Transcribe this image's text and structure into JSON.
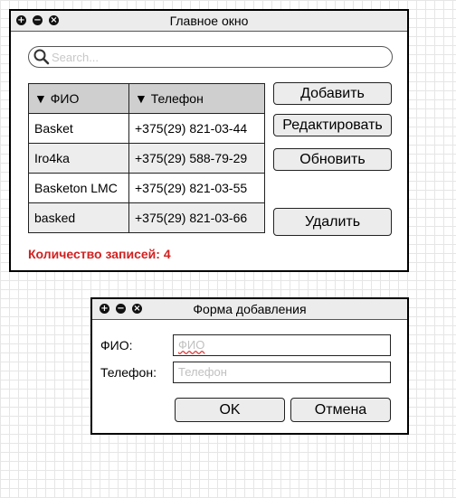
{
  "main_window": {
    "title": "Главное окно",
    "search_placeholder": "Search...",
    "table": {
      "columns": [
        "▼ ФИО",
        "▼ Телефон"
      ],
      "rows": [
        {
          "name": "Basket",
          "phone": "+375(29) 821-03-44"
        },
        {
          "name": "Iro4ka",
          "phone": "+375(29) 588-79-29"
        },
        {
          "name": "Basketon LMC",
          "phone": "+375(29) 821-03-55"
        },
        {
          "name": "basked",
          "phone": "+375(29) 821-03-66"
        }
      ]
    },
    "buttons": {
      "add": "Добавить",
      "edit": "Редактировать",
      "refresh": "Обновить",
      "delete": "Удалить"
    },
    "record_count": "Количество записей: 4"
  },
  "add_form": {
    "title": "Форма добавления",
    "name_label": "ФИО:",
    "name_placeholder": "ФИО",
    "phone_label": "Телефон:",
    "phone_placeholder": "Телефон",
    "ok": "OK",
    "cancel": "Отмена"
  },
  "colors": {
    "titlebar": "#ececec",
    "header": "#cfcfcf",
    "count_text": "#d32020"
  }
}
